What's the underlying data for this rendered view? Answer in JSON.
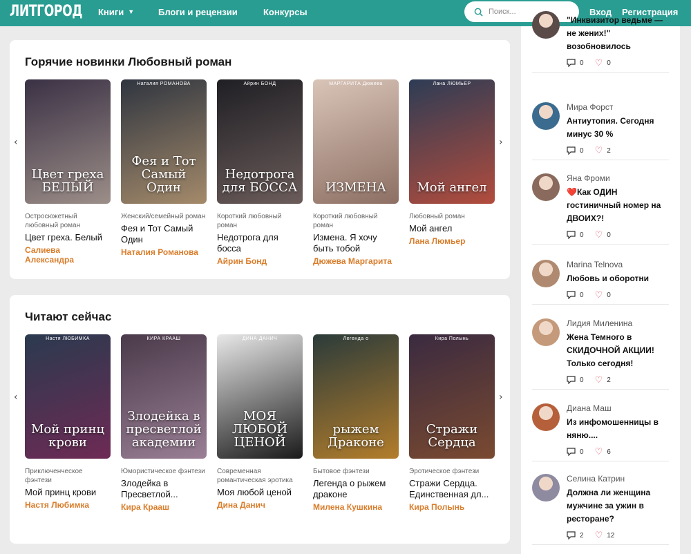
{
  "header": {
    "logo": "ЛИТГОРОД",
    "nav": {
      "books": "Книги",
      "blogs": "Блоги и рецензии",
      "contests": "Конкурсы"
    },
    "search_placeholder": "Поиск...",
    "login": "Вход",
    "register": "Регистрация"
  },
  "section_new": {
    "title": "Горячие новинки Любовный роман",
    "books": [
      {
        "genre": "Остросюжетный любовный роман",
        "title": "Цвет греха. Белый",
        "author": "Салиева Александра",
        "cover_author": "",
        "cover_title": "Цвет греха БЕЛЫЙ",
        "c1": "#3a3145",
        "c2": "#9c8e88"
      },
      {
        "genre": "Женский/семейный роман",
        "title": "Фея и Тот Самый Один",
        "author": "Наталия Романова",
        "cover_author": "Наталия РОМАНОВА",
        "cover_title": "Фея и Тот Самый Один",
        "c1": "#2f3540",
        "c2": "#a48a6a"
      },
      {
        "genre": "Короткий любовный роман",
        "title": "Недотрога для босса",
        "author": "Айрин Бонд",
        "cover_author": "Айрин БОНД",
        "cover_title": "Недотрога для БОССА",
        "c1": "#1f1f24",
        "c2": "#6b5c5a"
      },
      {
        "genre": "Короткий любовный роман",
        "title": "Измена. Я хочу быть тобой",
        "author": "Дюжева Маргарита",
        "cover_author": "МАРГАРИТА Дюжева",
        "cover_title": "ИЗМЕНА",
        "c1": "#d9c4b8",
        "c2": "#8d6f63"
      },
      {
        "genre": "Любовный роман",
        "title": "Мой ангел",
        "author": "Лана Люмьер",
        "cover_author": "Лана ЛЮМЬЕР",
        "cover_title": "Мой ангел",
        "c1": "#2d3c55",
        "c2": "#b24c3d"
      }
    ]
  },
  "section_reading": {
    "title": "Читают сейчас",
    "books": [
      {
        "genre": "Приключенческое фэнтези",
        "title": "Мой принц крови",
        "author": "Настя Любимка",
        "cover_author": "Настя ЛЮБИМКА",
        "cover_title": "Мой принц крови",
        "c1": "#2a3a4f",
        "c2": "#6e2a55"
      },
      {
        "genre": "Юмористическое фэнтези",
        "title": "Злодейка в Пресветлой...",
        "author": "Кира Крааш",
        "cover_author": "КИРА КРААШ",
        "cover_title": "Злодейка в пресветлой академии",
        "c1": "#4a3a4a",
        "c2": "#9a7f95"
      },
      {
        "genre": "Современная романтическая эротика",
        "title": "Моя любой ценой",
        "author": "Дина Данич",
        "cover_author": "ДИНА ДАНИЧ",
        "cover_title": "МОЯ ЛЮБОЙ ЦЕНОЙ",
        "c1": "#e8e8e8",
        "c2": "#1a1a1a"
      },
      {
        "genre": "Бытовое фэнтези",
        "title": "Легенда о рыжем драконе",
        "author": "Милена Кушкина",
        "cover_author": "Легенда о",
        "cover_title": "рыжем Драконе",
        "c1": "#2b3b3a",
        "c2": "#b37d2b"
      },
      {
        "genre": "Эротическое фэнтези",
        "title": "Стражи Сердца. Единственная дл...",
        "author": "Кира Полынь",
        "cover_author": "Кира Полынь",
        "cover_title": "Стражи Сердца",
        "c1": "#3a2a40",
        "c2": "#7a4a30"
      }
    ]
  },
  "sidebar": {
    "posts": [
      {
        "user": "",
        "title": "\"Инквизитор ведьме — не жених!\" возобновилось",
        "comments": "0",
        "likes": "0",
        "avatar_color": "#5a4a48"
      },
      {
        "user": "Мира Форст",
        "title": "Антиутопия. Сегодня минус 30 %",
        "comments": "0",
        "likes": "2",
        "avatar_color": "#3b6b8e"
      },
      {
        "user": "Яна Фроми",
        "title": "❤️Как ОДИН гостиничный номер на ДВОИХ?!",
        "comments": "0",
        "likes": "0",
        "avatar_color": "#8a6a5c"
      },
      {
        "user": "Marina Telnova",
        "title": "Любовь и оборотни",
        "comments": "0",
        "likes": "0",
        "avatar_color": "#b08a70"
      },
      {
        "user": "Лидия Миленина",
        "title": "Жена Темного в СКИДОЧНОЙ АКЦИИ! Только сегодня!",
        "comments": "0",
        "likes": "2",
        "avatar_color": "#c49a7a"
      },
      {
        "user": "Диана Маш",
        "title": "Из инфомошенницы в няню....",
        "comments": "0",
        "likes": "6",
        "avatar_color": "#b5603a"
      },
      {
        "user": "Селина Катрин",
        "title": "Должна ли женщина мужчине за ужин в ресторане?",
        "comments": "2",
        "likes": "12",
        "avatar_color": "#8e8aa0"
      }
    ]
  }
}
